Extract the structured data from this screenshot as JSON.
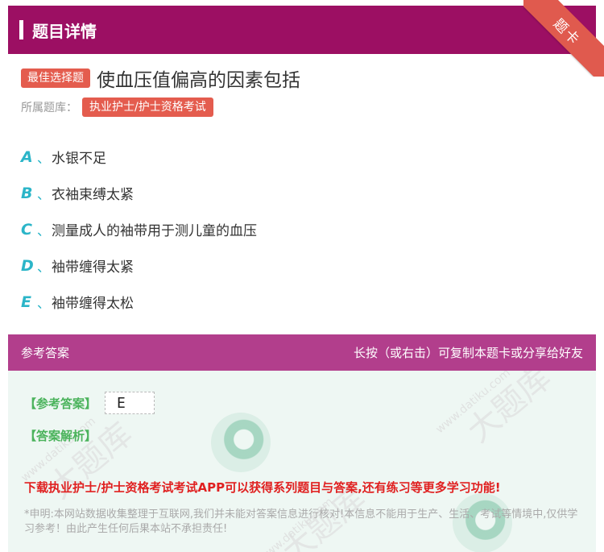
{
  "header": {
    "title": "题目详情"
  },
  "ribbon": {
    "label": "题卡"
  },
  "question": {
    "type_tag": "最佳选择题",
    "title": "使血压值偏高的因素包括",
    "library_label": "所属题库：",
    "library_tag": "执业护士/护士资格考试"
  },
  "options": [
    {
      "letter": "A",
      "sep": "、",
      "text": "水银不足"
    },
    {
      "letter": "B",
      "sep": "、",
      "text": "衣袖束缚太紧"
    },
    {
      "letter": "C",
      "sep": "、",
      "text": "测量成人的袖带用于测儿童的血压"
    },
    {
      "letter": "D",
      "sep": "、",
      "text": "袖带缠得太紧"
    },
    {
      "letter": "E",
      "sep": "、",
      "text": "袖带缠得太松"
    }
  ],
  "answer_section": {
    "header_left": "参考答案",
    "header_right": "长按（或右击）可复制本题卡或分享给好友",
    "answer_label": "【参考答案】",
    "answer_value": "E",
    "analysis_label": "【答案解析】",
    "promo": "下载执业护士/护士资格考试考试APP可以获得系列题目与答案,还有练习等更多学习功能!",
    "disclaimer": "*申明:本网站数据收集整理于互联网,我们并未能对答案信息进行核对!本信息不能用于生产、生活、考试等情境中,仅供学习参考！由此产生任何后果本站不承担责任!"
  },
  "watermark": {
    "text": "大题库",
    "url": "www.datiku.com"
  },
  "colors": {
    "header_bg": "#9c0f63",
    "answer_header_bg": "#b23e8c",
    "tag_red": "#e45c4e",
    "option_letter": "#2bb5c8",
    "answer_bg": "#eef7f3"
  }
}
